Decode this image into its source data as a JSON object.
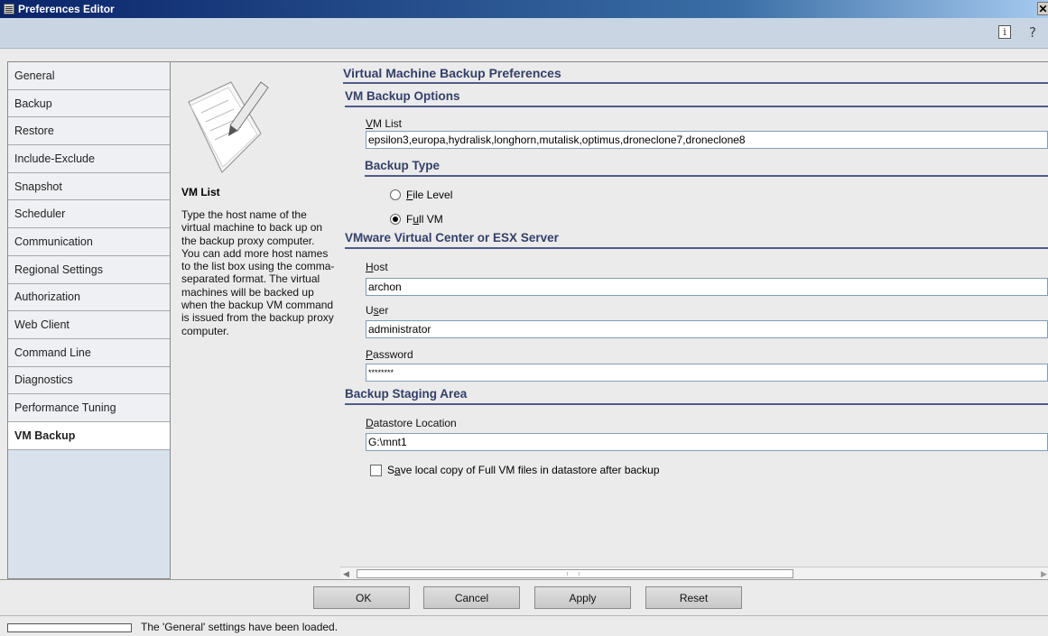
{
  "window": {
    "title": "Preferences Editor",
    "close_glyph": "✕"
  },
  "toolbar": {
    "info_glyph": "i",
    "help_glyph": "?"
  },
  "nav": {
    "items": [
      {
        "label": "General"
      },
      {
        "label": "Backup"
      },
      {
        "label": "Restore"
      },
      {
        "label": "Include-Exclude"
      },
      {
        "label": "Snapshot"
      },
      {
        "label": "Scheduler"
      },
      {
        "label": "Communication"
      },
      {
        "label": "Regional Settings"
      },
      {
        "label": "Authorization"
      },
      {
        "label": "Web Client"
      },
      {
        "label": "Command Line"
      },
      {
        "label": "Diagnostics"
      },
      {
        "label": "Performance Tuning"
      },
      {
        "label": "VM Backup",
        "active": true
      }
    ]
  },
  "description": {
    "title": "VM List",
    "text": "Type the host name of the virtual machine to back up on the backup proxy computer. You can add more host names to the list box using the comma-separated format. The virtual machines will be backed up when the backup VM command is issued from the backup proxy computer."
  },
  "content": {
    "heading": "Virtual Machine Backup Preferences",
    "vm_backup_options": {
      "heading": "VM Backup Options",
      "vm_list_label_mnemonic": "V",
      "vm_list_label_rest": "M List",
      "vm_list_value": "epsilon3,europa,hydralisk,longhorn,mutalisk,optimus,droneclone7,droneclone8"
    },
    "backup_type": {
      "heading": "Backup Type",
      "options": [
        {
          "mnemonic": "F",
          "rest": "ile Level",
          "checked": false
        },
        {
          "prefix": "F",
          "mnemonic": "u",
          "rest": "ll VM",
          "checked": true
        }
      ]
    },
    "server": {
      "heading": "VMware Virtual Center or ESX Server",
      "host_label_mnemonic": "H",
      "host_label_rest": "ost",
      "host_value": "archon",
      "user_label_prefix": "U",
      "user_label_mnemonic": "s",
      "user_label_rest": "er",
      "user_value": "administrator",
      "password_label_mnemonic": "P",
      "password_label_rest": "assword",
      "password_value": "********"
    },
    "staging": {
      "heading": "Backup Staging Area",
      "datastore_label_mnemonic": "D",
      "datastore_label_rest": "atastore Location",
      "datastore_value": "G:\\mnt1",
      "save_copy_prefix": "S",
      "save_copy_mnemonic": "a",
      "save_copy_rest": "ve local copy of Full VM files in datastore after backup",
      "save_copy_checked": false
    }
  },
  "buttons": {
    "ok": "OK",
    "cancel": "Cancel",
    "apply": "Apply",
    "reset": "Reset"
  },
  "status": {
    "text": "The 'General' settings have been loaded."
  }
}
